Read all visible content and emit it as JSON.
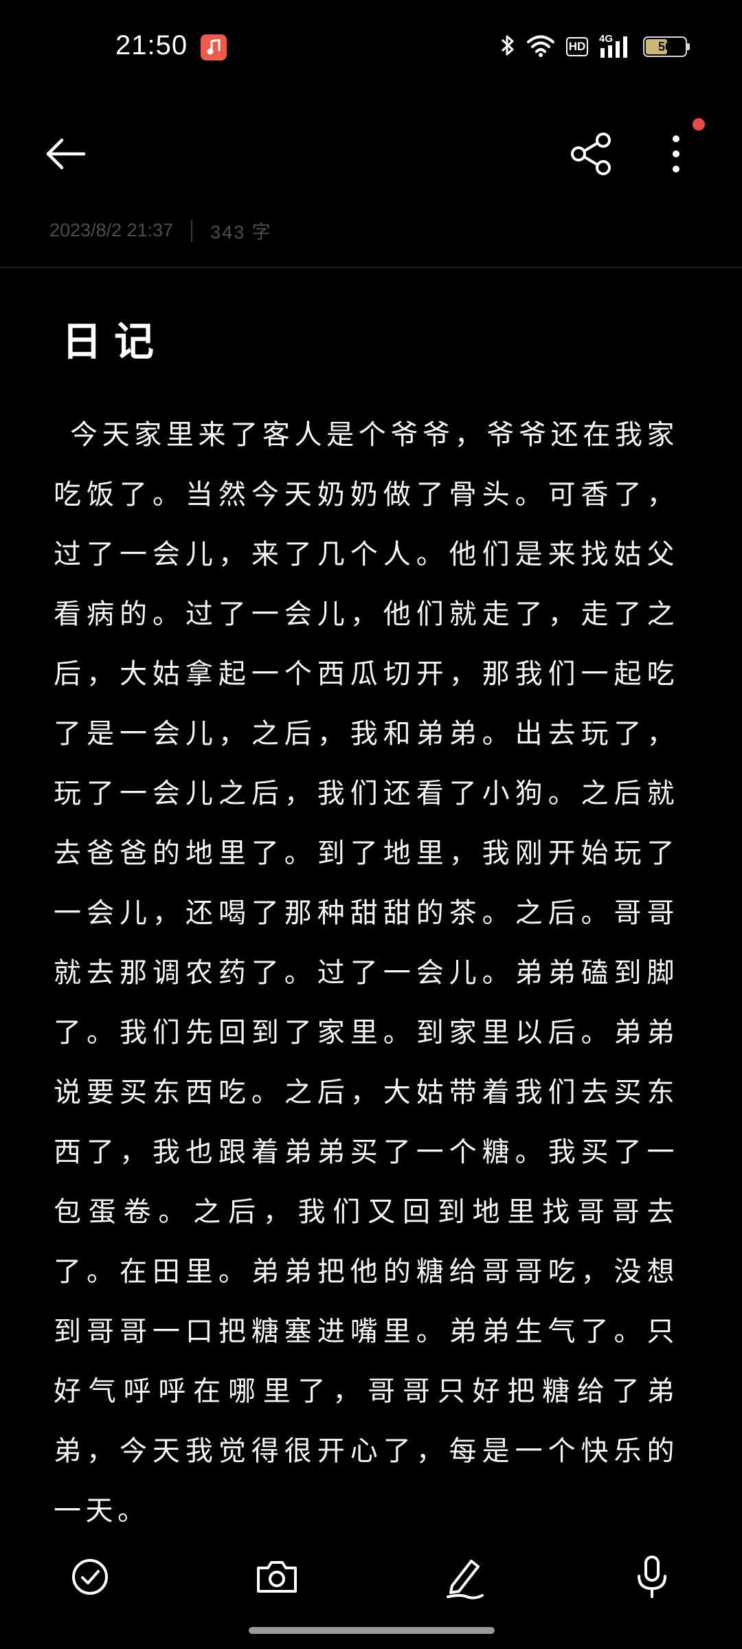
{
  "status_bar": {
    "time": "21:50",
    "hd_label": "HD",
    "network_label": "4G",
    "battery_level": "56",
    "battery_fraction": 0.56,
    "icons": [
      "music-app-icon",
      "bluetooth-icon",
      "wifi-icon",
      "hd-voice-icon",
      "cellular-signal-icon",
      "battery-icon"
    ]
  },
  "toolbar": {
    "icons": [
      "back-arrow-icon",
      "share-icon",
      "more-vertical-icon"
    ],
    "has_notification_dot": true
  },
  "meta": {
    "datetime": "2023/8/2 21:37",
    "word_count": "343 字"
  },
  "note": {
    "title": "日记",
    "body": "今天家里来了客人是个爷爷，爷爷还在我家吃饭了。当然今天奶奶做了骨头。可香了，过了一会儿，来了几个人。他们是来找姑父看病的。过了一会儿，他们就走了，走了之后，大姑拿起一个西瓜切开，那我们一起吃了是一会儿，之后，我和弟弟。出去玩了，玩了一会儿之后，我们还看了小狗。之后就去爸爸的地里了。到了地里，我刚开始玩了一会儿，还喝了那种甜甜的茶。之后。哥哥就去那调农药了。过了一会儿。弟弟磕到脚了。我们先回到了家里。到家里以后。弟弟说要买东西吃。之后，大姑带着我们去买东西了，我也跟着弟弟买了一个糖。我买了一包蛋卷。之后，我们又回到地里找哥哥去了。在田里。弟弟把他的糖给哥哥吃，没想到哥哥一口把糖塞进嘴里。弟弟生气了。只好气呼呼在哪里了，哥哥只好把糖给了弟弟，今天我觉得很开心了，每是一个快乐的一天。"
  },
  "bottom_bar": {
    "icons": [
      "checklist-icon",
      "camera-icon",
      "handwriting-pen-icon",
      "microphone-icon"
    ]
  },
  "colors": {
    "background": "#000000",
    "text": "#ffffff",
    "meta_text": "#4d4d4d",
    "notification_dot": "#e84a4a",
    "music_badge": "#ef5a4a",
    "battery_fill": "#c9b873"
  }
}
